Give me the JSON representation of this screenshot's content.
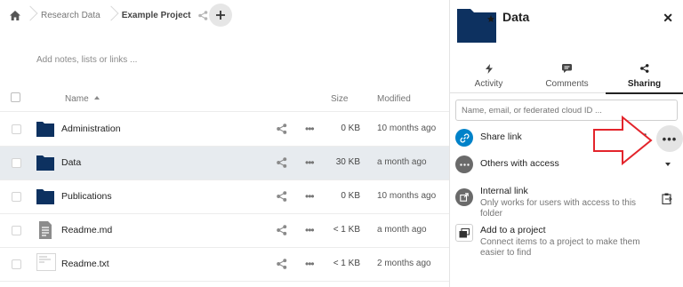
{
  "breadcrumb": {
    "items": [
      "Research Data",
      "Example Project"
    ]
  },
  "notes_placeholder": "Add notes, lists or links ...",
  "table": {
    "columns": {
      "name": "Name",
      "size": "Size",
      "modified": "Modified"
    },
    "rows": [
      {
        "name": "Administration",
        "type": "folder",
        "size": "0 KB",
        "modified": "10 months ago",
        "selected": false
      },
      {
        "name": "Data",
        "type": "folder",
        "size": "30 KB",
        "modified": "a month ago",
        "selected": true
      },
      {
        "name": "Publications",
        "type": "folder",
        "size": "0 KB",
        "modified": "10 months ago",
        "selected": false
      },
      {
        "name": "Readme.md",
        "type": "markdown-file",
        "size": "< 1 KB",
        "modified": "a month ago",
        "selected": false
      },
      {
        "name": "Readme.txt",
        "type": "text-file",
        "size": "< 1 KB",
        "modified": "2 months ago",
        "selected": false
      }
    ]
  },
  "sidebar": {
    "title": "Data",
    "tabs": [
      {
        "label": "Activity",
        "icon": "lightning-icon",
        "active": false
      },
      {
        "label": "Comments",
        "icon": "comment-icon",
        "active": false
      },
      {
        "label": "Sharing",
        "icon": "share-icon",
        "active": true
      }
    ],
    "search_placeholder": "Name, email, or federated cloud ID ...",
    "share_link": {
      "title": "Share link"
    },
    "others_access": {
      "title": "Others with access"
    },
    "internal_link": {
      "title": "Internal link",
      "subtitle": "Only works for users with access to this folder"
    },
    "add_project": {
      "title": "Add to a project",
      "subtitle": "Connect items to a project to make them easier to find"
    }
  },
  "colors": {
    "folder": "#0d3160",
    "accent_blue": "#0082c9",
    "selected_row": "#e7ebef",
    "annotation_red": "#e3242b"
  }
}
